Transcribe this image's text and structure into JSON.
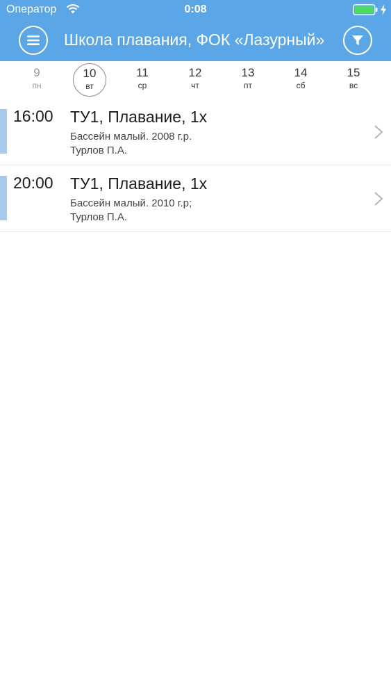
{
  "status_bar": {
    "carrier": "Оператор",
    "time": "0:08",
    "battery_color": "#4cd964"
  },
  "nav": {
    "title": "Школа плавания, ФОК «Лазурный»",
    "accent_color": "#5aa6e6",
    "menu_icon": "hamburger-icon",
    "filter_icon": "funnel-icon"
  },
  "week": {
    "days": [
      {
        "num": "9",
        "abbr": "пн"
      },
      {
        "num": "10",
        "abbr": "вт"
      },
      {
        "num": "11",
        "abbr": "ср"
      },
      {
        "num": "12",
        "abbr": "чт"
      },
      {
        "num": "13",
        "abbr": "пт"
      },
      {
        "num": "14",
        "abbr": "сб"
      },
      {
        "num": "15",
        "abbr": "вс"
      }
    ],
    "selected": "10"
  },
  "lessons": [
    {
      "time": "16:00",
      "title": "ТУ1, Плавание, 1х",
      "place": "Бассейн малый. 2008 г.р.",
      "teacher": "Турлов П.А."
    },
    {
      "time": "20:00",
      "title": "ТУ1, Плавание, 1х",
      "place": "Бассейн малый. 2010 г.р;",
      "teacher": "Турлов П.А."
    }
  ]
}
